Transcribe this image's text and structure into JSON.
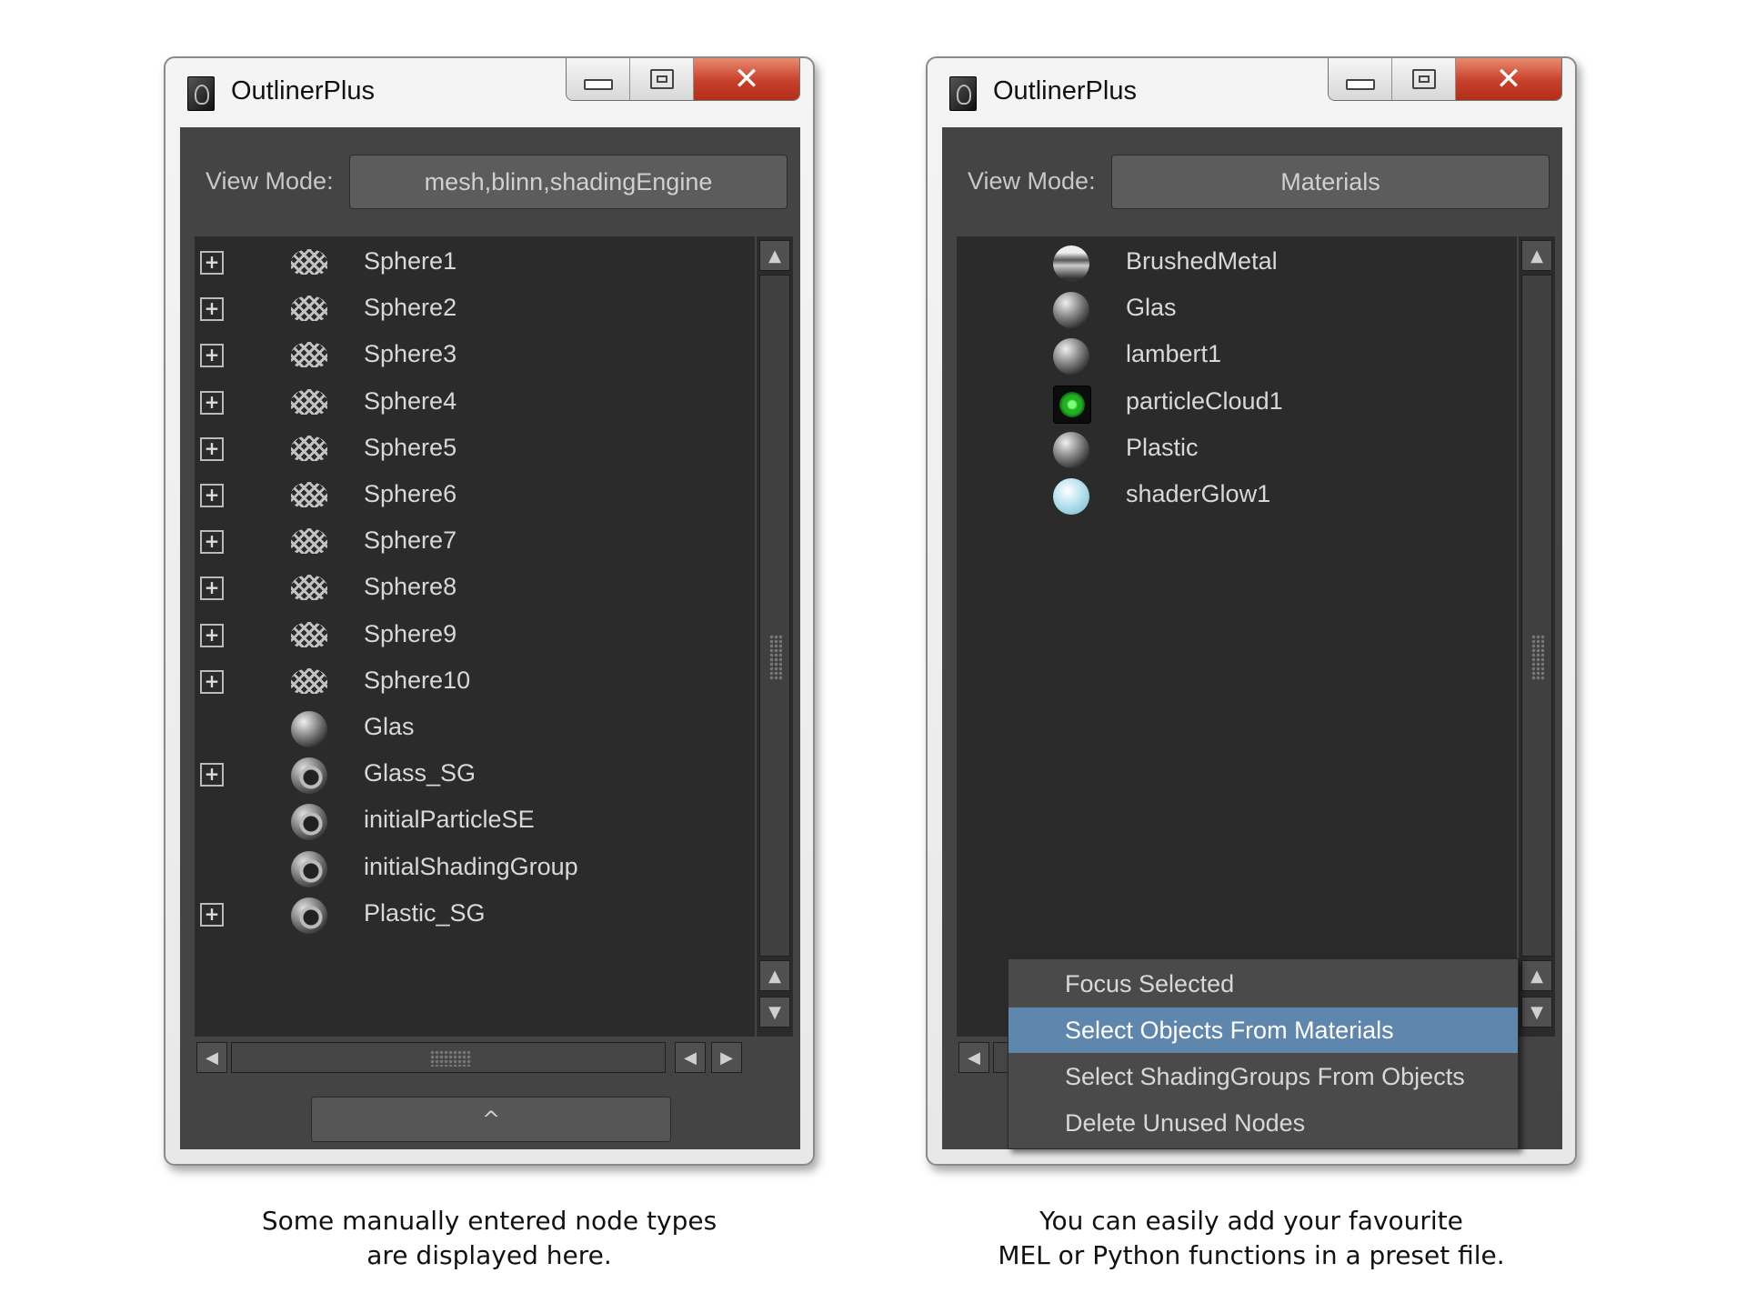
{
  "left_window": {
    "title": "OutlinerPlus",
    "view_mode_label": "View Mode:",
    "view_mode_value": "mesh,blinn,shadingEngine",
    "items": [
      {
        "label": "Sphere1",
        "expandable": true,
        "icon": "mesh-icon"
      },
      {
        "label": "Sphere2",
        "expandable": true,
        "icon": "mesh-icon"
      },
      {
        "label": "Sphere3",
        "expandable": true,
        "icon": "mesh-icon"
      },
      {
        "label": "Sphere4",
        "expandable": true,
        "icon": "mesh-icon"
      },
      {
        "label": "Sphere5",
        "expandable": true,
        "icon": "mesh-icon"
      },
      {
        "label": "Sphere6",
        "expandable": true,
        "icon": "mesh-icon"
      },
      {
        "label": "Sphere7",
        "expandable": true,
        "icon": "mesh-icon"
      },
      {
        "label": "Sphere8",
        "expandable": true,
        "icon": "mesh-icon"
      },
      {
        "label": "Sphere9",
        "expandable": true,
        "icon": "mesh-icon"
      },
      {
        "label": "Sphere10",
        "expandable": true,
        "icon": "mesh-icon"
      },
      {
        "label": "Glas",
        "expandable": false,
        "icon": "material-sphere-icon"
      },
      {
        "label": "Glass_SG",
        "expandable": true,
        "icon": "shading-group-icon"
      },
      {
        "label": "initialParticleSE",
        "expandable": false,
        "icon": "shading-group-icon"
      },
      {
        "label": "initialShadingGroup",
        "expandable": false,
        "icon": "shading-group-icon"
      },
      {
        "label": "Plastic_SG",
        "expandable": true,
        "icon": "shading-group-icon"
      }
    ],
    "bottom_button": "^",
    "caption_line1": "Some manually entered node types",
    "caption_line2": "are displayed here."
  },
  "right_window": {
    "title": "OutlinerPlus",
    "view_mode_label": "View Mode:",
    "view_mode_value": "Materials",
    "items": [
      {
        "label": "BrushedMetal",
        "icon": "brushed-metal-icon"
      },
      {
        "label": "Glas",
        "icon": "material-sphere-icon"
      },
      {
        "label": "lambert1",
        "icon": "material-sphere-icon"
      },
      {
        "label": "particleCloud1",
        "icon": "particle-cloud-icon"
      },
      {
        "label": "Plastic",
        "icon": "material-sphere-icon"
      },
      {
        "label": "shaderGlow1",
        "icon": "shader-glow-icon"
      }
    ],
    "context_menu": [
      {
        "label": "Focus Selected",
        "active": false
      },
      {
        "label": "Select Objects From Materials",
        "active": true
      },
      {
        "label": "Select ShadingGroups From Objects",
        "active": false
      },
      {
        "label": "Delete Unused Nodes",
        "active": false
      }
    ],
    "bottom_button": "^",
    "caption_line1": "You can easily add your favourite",
    "caption_line2": "MEL or Python functions in a preset file."
  },
  "colors": {
    "panel_bg": "#444444",
    "list_bg": "#2b2b2b",
    "menu_highlight": "#5f86ad",
    "close_button": "#c7402a"
  }
}
